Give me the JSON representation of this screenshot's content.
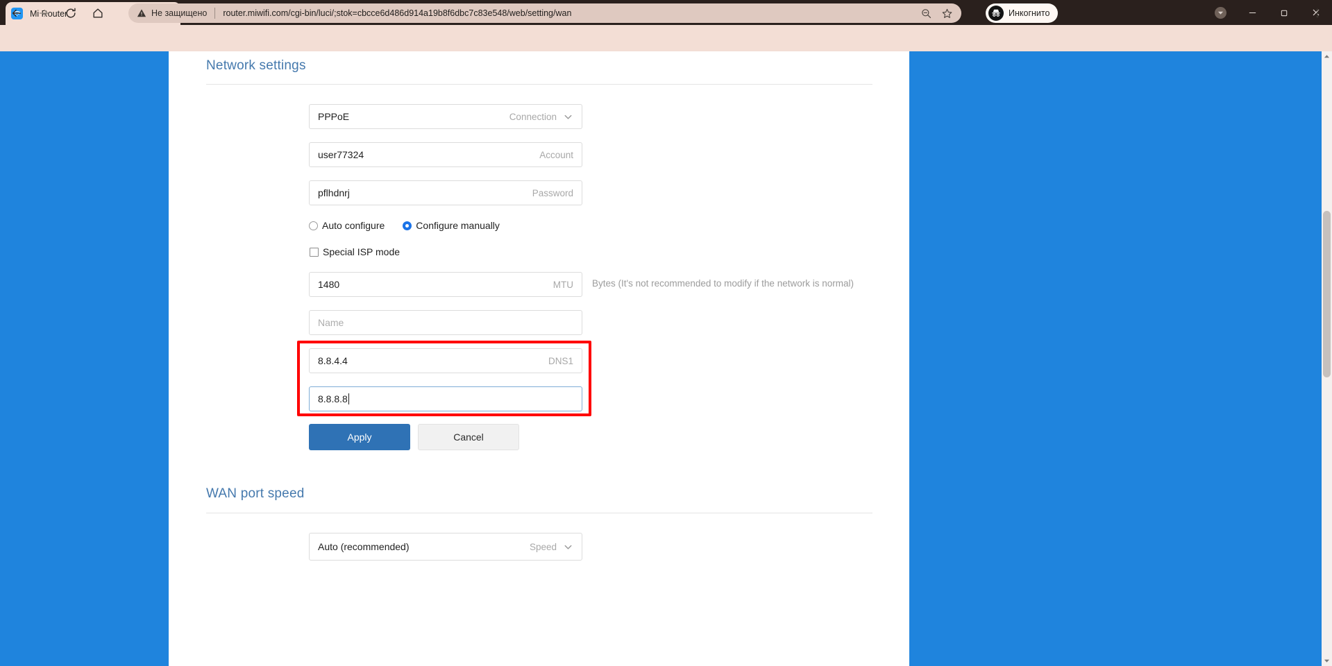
{
  "browser": {
    "tab": {
      "title": "Mi Router",
      "favicon": "wifi-icon"
    },
    "new_tab_label": "+",
    "window_controls": {
      "minimize": "–",
      "maximize": "❐",
      "close": "✕"
    },
    "omnibox": {
      "security_warning": "Не защищено",
      "url": "router.miwifi.com/cgi-bin/luci/;stok=cbcce6d486d914a19b8f6dbc7c83e548/web/setting/wan"
    },
    "profile": {
      "label": "Инкогнито"
    }
  },
  "page": {
    "sections": {
      "network_settings": {
        "title": "Network settings"
      },
      "wan_port_speed": {
        "title": "WAN port speed"
      }
    },
    "fields": {
      "connection": {
        "value": "PPPoE",
        "label": "Connection"
      },
      "account": {
        "value": "user77324",
        "label": "Account"
      },
      "password": {
        "value": "pflhdnrj",
        "label": "Password"
      },
      "mtu": {
        "value": "1480",
        "label": "MTU",
        "hint": "Bytes (It's not recommended to modify if the network is normal)"
      },
      "name": {
        "value": "",
        "placeholder": "Name",
        "label": ""
      },
      "dns1": {
        "value": "8.8.4.4",
        "label": "DNS1"
      },
      "dns2": {
        "value": "8.8.8.8",
        "label": ""
      },
      "speed": {
        "value": "Auto (recommended)",
        "label": "Speed"
      }
    },
    "radios": [
      {
        "label": "Auto configure",
        "selected": false
      },
      {
        "label": "Configure manually",
        "selected": true
      }
    ],
    "checkbox": {
      "label": "Special ISP mode",
      "checked": false
    },
    "buttons": {
      "apply": "Apply",
      "cancel": "Cancel"
    }
  },
  "colors": {
    "page_background": "#1f84dd",
    "accent_blue": "#2f72b5",
    "heading_blue": "#4579ad",
    "annotation_red": "#ff0000",
    "radio_selected": "#1a73e8"
  }
}
